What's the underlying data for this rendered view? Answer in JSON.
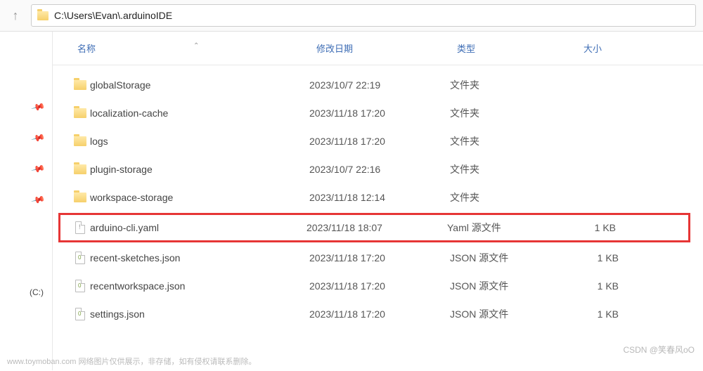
{
  "addressBar": {
    "path": "C:\\Users\\Evan\\.arduinoIDE"
  },
  "columns": {
    "name": "名称",
    "date": "修改日期",
    "type": "类型",
    "size": "大小"
  },
  "sidebar": {
    "drive": "(C:)"
  },
  "files": [
    {
      "icon": "folder",
      "name": "globalStorage",
      "date": "2023/10/7 22:19",
      "type": "文件夹",
      "size": ""
    },
    {
      "icon": "folder",
      "name": "localization-cache",
      "date": "2023/11/18 17:20",
      "type": "文件夹",
      "size": ""
    },
    {
      "icon": "folder",
      "name": "logs",
      "date": "2023/11/18 17:20",
      "type": "文件夹",
      "size": ""
    },
    {
      "icon": "folder",
      "name": "plugin-storage",
      "date": "2023/10/7 22:16",
      "type": "文件夹",
      "size": ""
    },
    {
      "icon": "folder",
      "name": "workspace-storage",
      "date": "2023/11/18 12:14",
      "type": "文件夹",
      "size": ""
    },
    {
      "icon": "yaml",
      "name": "arduino-cli.yaml",
      "date": "2023/11/18 18:07",
      "type": "Yaml 源文件",
      "size": "1 KB",
      "highlighted": true
    },
    {
      "icon": "json",
      "name": "recent-sketches.json",
      "date": "2023/11/18 17:20",
      "type": "JSON 源文件",
      "size": "1 KB"
    },
    {
      "icon": "json",
      "name": "recentworkspace.json",
      "date": "2023/11/18 17:20",
      "type": "JSON 源文件",
      "size": "1 KB"
    },
    {
      "icon": "json",
      "name": "settings.json",
      "date": "2023/11/18 17:20",
      "type": "JSON 源文件",
      "size": "1 KB"
    }
  ],
  "footer": {
    "note": "www.toymoban.com 网络图片仅供展示，非存储，如有侵权请联系删除。",
    "watermark": "CSDN @笑春风oO"
  }
}
